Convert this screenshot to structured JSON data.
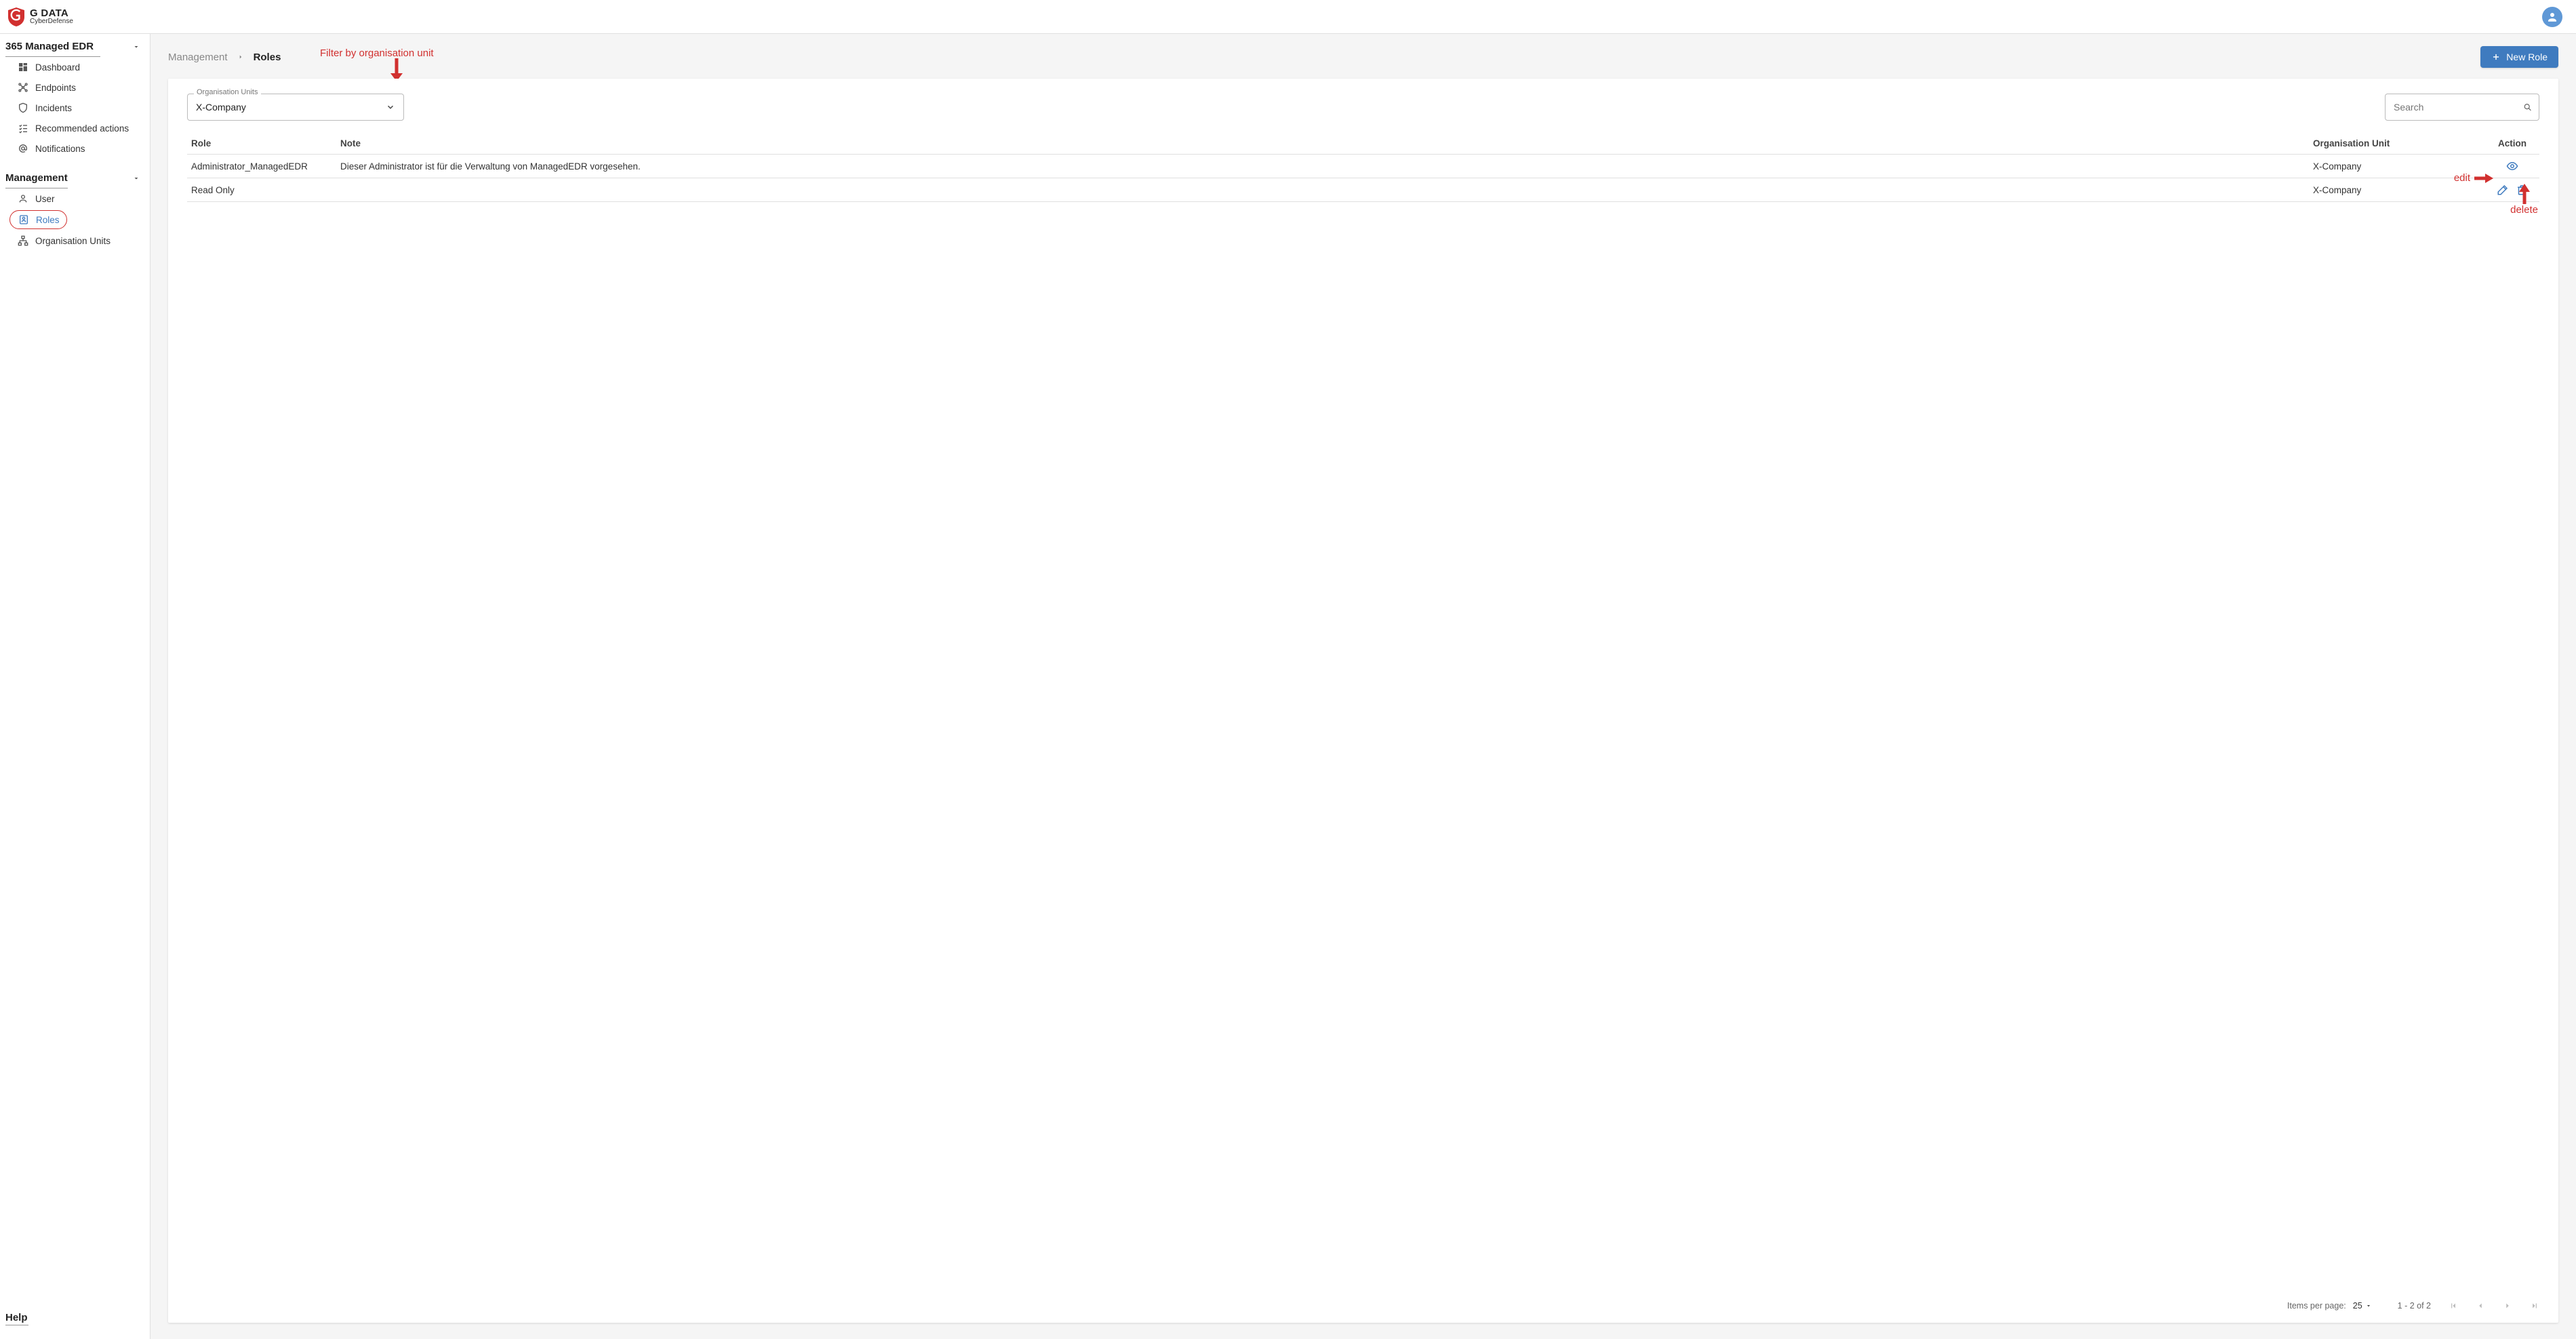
{
  "brand": {
    "line1": "G DATA",
    "line2": "CyberDefense"
  },
  "sidebar": {
    "section_edr": {
      "title": "365 Managed EDR",
      "items": [
        {
          "label": "Dashboard"
        },
        {
          "label": "Endpoints"
        },
        {
          "label": "Incidents"
        },
        {
          "label": "Recommended actions"
        },
        {
          "label": "Notifications"
        }
      ]
    },
    "section_mgmt": {
      "title": "Management",
      "items": [
        {
          "label": "User"
        },
        {
          "label": "Roles"
        },
        {
          "label": "Organisation Units"
        }
      ]
    },
    "section_help": {
      "title": "Help"
    }
  },
  "breadcrumb": {
    "parent": "Management",
    "current": "Roles"
  },
  "new_role_button": "New Role",
  "filter": {
    "ou_legend": "Organisation Units",
    "ou_value": "X-Company",
    "search_placeholder": "Search"
  },
  "table": {
    "headers": {
      "role": "Role",
      "note": "Note",
      "ou": "Organisation Unit",
      "action": "Action"
    },
    "rows": [
      {
        "role": "Administrator_ManagedEDR",
        "note": "Dieser Administrator ist für die Verwaltung von ManagedEDR vorgesehen.",
        "ou": "X-Company",
        "action_type": "view"
      },
      {
        "role": "Read Only",
        "note": "",
        "ou": "X-Company",
        "action_type": "edit_delete"
      }
    ]
  },
  "paginator": {
    "items_per_page_label": "Items per page:",
    "items_per_page_value": "25",
    "range": "1 - 2 of 2"
  },
  "annotations": {
    "filter": "Filter by organisation unit",
    "edit": "edit",
    "delete": "delete"
  }
}
